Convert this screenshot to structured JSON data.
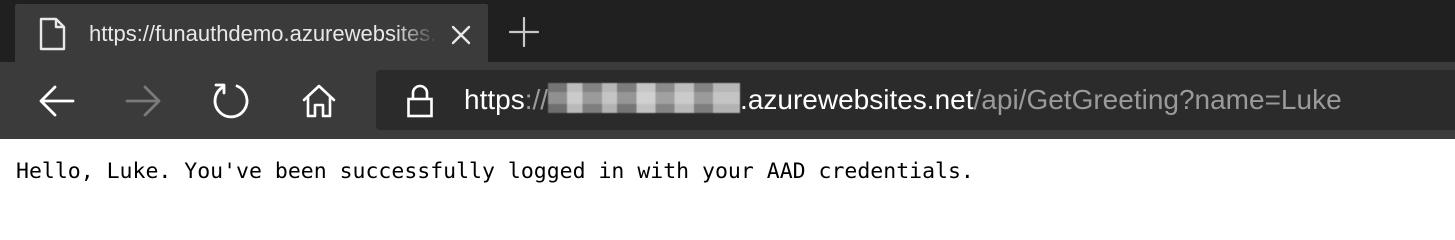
{
  "tab": {
    "title": "https://funauthdemo.azurewebsites.net/api/GetGreeting?name=Luke",
    "page_icon": "page-icon",
    "close_icon": "close-icon"
  },
  "toolbar": {
    "new_tab_icon": "plus-icon",
    "back_icon": "arrow-left-icon",
    "forward_icon": "arrow-right-icon",
    "refresh_icon": "refresh-icon",
    "home_icon": "home-icon"
  },
  "address_bar": {
    "lock_icon": "lock-icon",
    "scheme": "https",
    "separator": "://",
    "redacted_subdomain": "funauthdemo",
    "domain": ".azurewebsites.net",
    "path": "/api/GetGreeting?name=Luke"
  },
  "page": {
    "message": "Hello, Luke. You've been successfully logged in with your AAD credentials."
  },
  "colors": {
    "tabstrip": "#202020",
    "toolbar": "#3b3b3b",
    "address_bar": "#2b2b2b",
    "url_bright": "#ffffff",
    "url_dim": "#9a9a9a"
  }
}
